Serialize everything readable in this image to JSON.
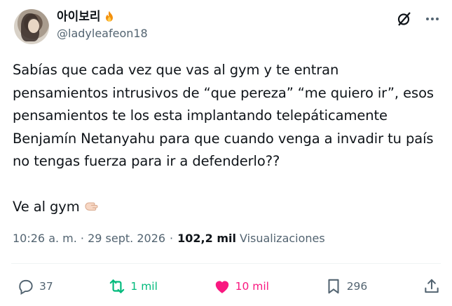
{
  "author": {
    "display_name": "아이보리",
    "handle": "@ladyleafeon18"
  },
  "tweet": {
    "text": "Sabías que cada vez que vas al gym y te entran\npensamientos intrusivos de “que pereza” “me quiero ir”, esos\npensamientos te los esta implantando telepáticamente\nBenjamín Netanyahu para que cuando venga a invadir tu país\nno tengas fuerza para ir a defenderlo??\n\nVe al gym"
  },
  "meta": {
    "timestamp": "10:26 a. m. · 29 sept. 2026",
    "separator": "·",
    "views_count": "102,2 mil",
    "views_label": "Visualizaciones"
  },
  "actions": {
    "replies": "37",
    "reposts": "1 mil",
    "likes": "10 mil",
    "bookmarks": "296"
  },
  "colors": {
    "text": "#0f1419",
    "muted": "#536471",
    "repost_active": "#00ba7c",
    "like_active": "#f91880",
    "divider": "#eff3f4"
  },
  "icons": {
    "name_emoji": "fire-icon",
    "text_emoji": "pointing-hand-icon",
    "header": [
      "grok-icon",
      "more-icon"
    ],
    "actions": [
      "reply-icon",
      "repost-icon",
      "like-icon",
      "bookmark-icon",
      "share-icon"
    ]
  }
}
